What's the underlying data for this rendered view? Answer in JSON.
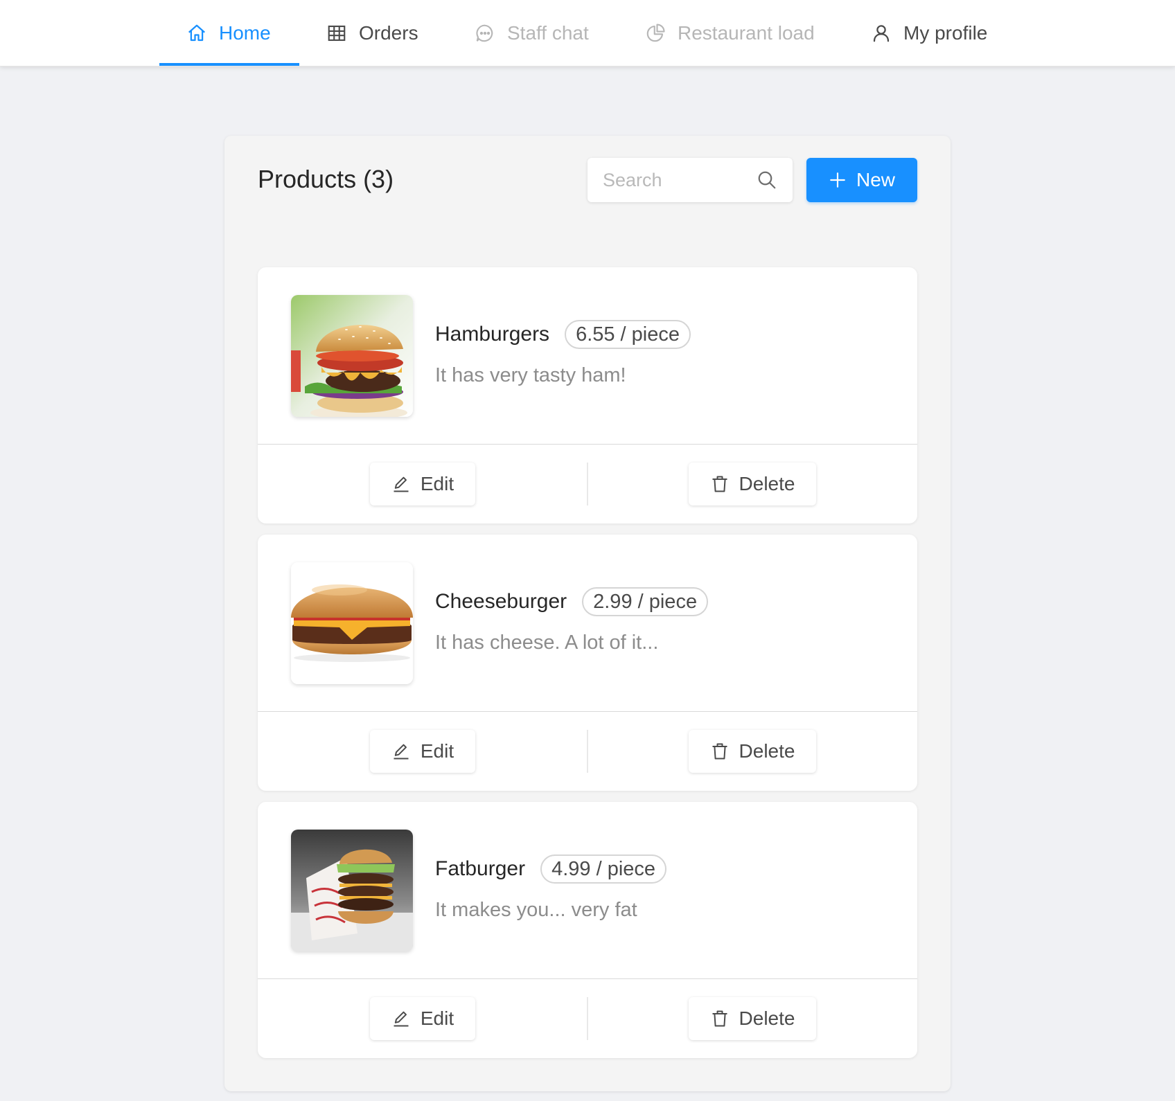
{
  "nav": {
    "items": [
      {
        "label": "Home",
        "icon": "home-icon",
        "state": "active"
      },
      {
        "label": "Orders",
        "icon": "table-icon",
        "state": "normal"
      },
      {
        "label": "Staff chat",
        "icon": "chat-icon",
        "state": "disabled"
      },
      {
        "label": "Restaurant load",
        "icon": "pie-chart-icon",
        "state": "disabled"
      },
      {
        "label": "My profile",
        "icon": "user-icon",
        "state": "normal"
      }
    ]
  },
  "products": {
    "title": "Products (3)",
    "search": {
      "placeholder": "Search",
      "value": ""
    },
    "new_label": "New",
    "edit_label": "Edit",
    "delete_label": "Delete",
    "items": [
      {
        "name": "Hamburgers",
        "price": "6.55 / piece",
        "description": "It has very tasty ham!",
        "image": "hamburger-photo"
      },
      {
        "name": "Cheeseburger",
        "price": "2.99 / piece",
        "description": "It has cheese. A lot of it...",
        "image": "cheeseburger-photo"
      },
      {
        "name": "Fatburger",
        "price": "4.99 / piece",
        "description": "It makes you... very fat",
        "image": "fatburger-photo"
      }
    ]
  },
  "colors": {
    "accent": "#1890ff",
    "background": "#f0f1f4",
    "panel": "#f4f4f4",
    "card": "#ffffff",
    "muted_text": "#8c8c8c",
    "disabled_text": "#b6b6b6"
  }
}
